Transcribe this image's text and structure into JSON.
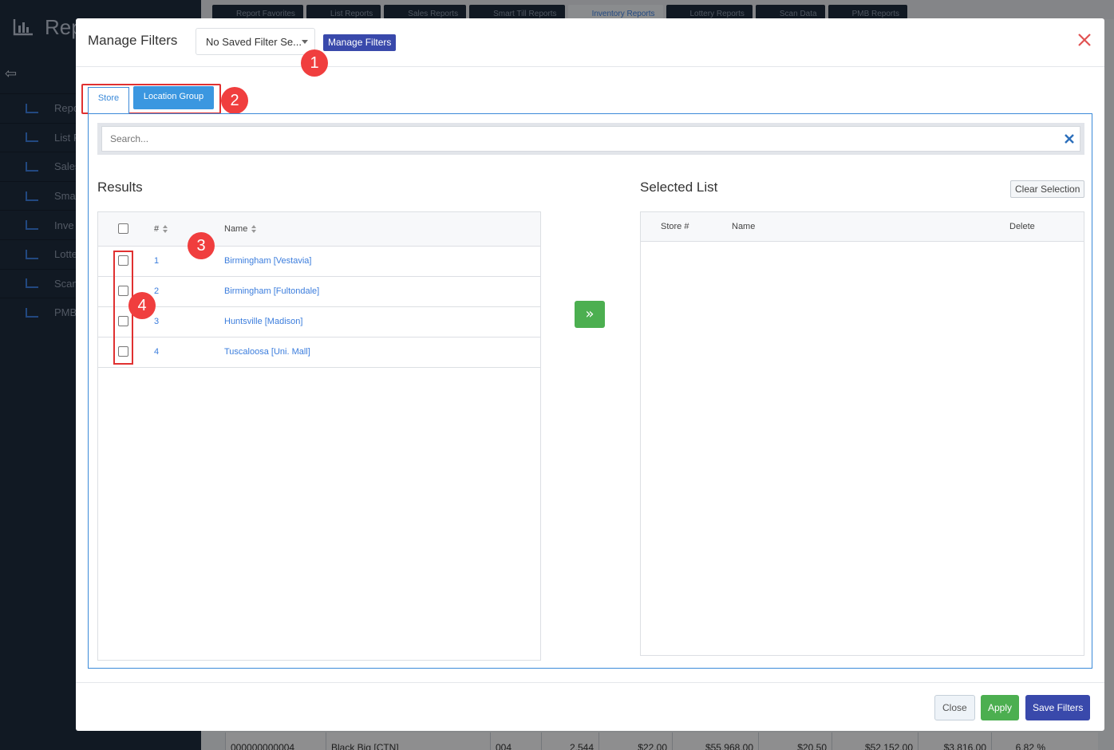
{
  "background": {
    "brand_text": "Rep",
    "nav_items": [
      "Repo",
      "List R",
      "Sales",
      "Sma",
      "Inve",
      "Lotte",
      "Scan",
      "PMB"
    ],
    "top_tabs": [
      {
        "label": "Report Favorites",
        "active": false
      },
      {
        "label": "List Reports",
        "active": false
      },
      {
        "label": "Sales Reports",
        "active": false
      },
      {
        "label": "Smart Till Reports",
        "active": false
      },
      {
        "label": "Inventory Reports",
        "active": true
      },
      {
        "label": "Lottery Reports",
        "active": false
      },
      {
        "label": "Scan Data",
        "active": false
      },
      {
        "label": "PMB Reports",
        "active": false
      }
    ],
    "table_row": [
      "000000000004",
      "Black Big [CTN]",
      "004",
      "2,544",
      "$22.00",
      "$55,968.00",
      "$20.50",
      "$52,152.00",
      "$3,816.00",
      "6.82 %"
    ]
  },
  "modal": {
    "title": "Manage Filters",
    "saved_filter_select": "No Saved Filter Se...",
    "manage_filters_button": "Manage Filters",
    "tabs": {
      "store": "Store",
      "location_group": "Location Group"
    },
    "search": {
      "placeholder": "Search..."
    },
    "results": {
      "title": "Results",
      "columns": {
        "number": "#",
        "name": "Name"
      },
      "rows": [
        {
          "number": "1",
          "name": "Birmingham [Vestavia]"
        },
        {
          "number": "2",
          "name": "Birmingham [Fultondale]"
        },
        {
          "number": "3",
          "name": "Huntsville [Madison]"
        },
        {
          "number": "4",
          "name": "Tuscaloosa [Uni. Mall]"
        }
      ]
    },
    "move_button_icon": "double-chevron-right-icon",
    "move_button_glyph": "»",
    "selected_list": {
      "title": "Selected List",
      "clear_button": "Clear Selection",
      "columns": {
        "store_number": "Store #",
        "name": "Name",
        "delete": "Delete"
      }
    },
    "footer": {
      "close": "Close",
      "apply": "Apply",
      "save": "Save Filters"
    },
    "annotations": [
      "1",
      "2",
      "3",
      "4"
    ],
    "colors": {
      "primary": "#3949ab",
      "tab_active": "#3b97e0",
      "success": "#4caf50",
      "annotation_red": "#f03e3e",
      "link_blue": "#3b7ddd"
    }
  }
}
